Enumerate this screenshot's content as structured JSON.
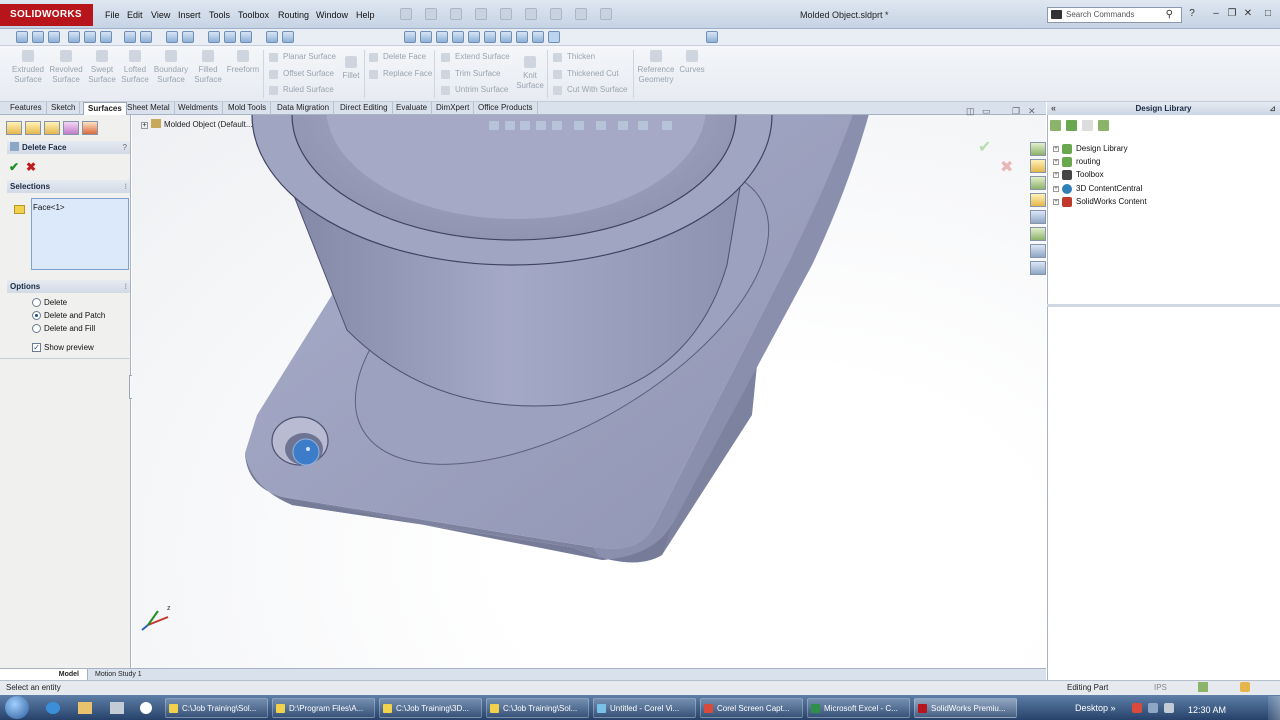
{
  "app": {
    "logo": "SOLIDWORKS",
    "doc_title": "Molded Object.sldprt *",
    "search_placeholder": "Search Commands"
  },
  "menu": [
    "File",
    "Edit",
    "View",
    "Insert",
    "Tools",
    "Toolbox",
    "Routing",
    "Window",
    "Help"
  ],
  "command_manager": {
    "big": [
      {
        "label": "Extruded\nSurface"
      },
      {
        "label": "Revolved\nSurface"
      },
      {
        "label": "Swept\nSurface"
      },
      {
        "label": "Lofted\nSurface"
      },
      {
        "label": "Boundary\nSurface"
      },
      {
        "label": "Filled\nSurface"
      },
      {
        "label": "Freeform"
      }
    ],
    "col1": [
      "Planar Surface",
      "Offset Surface",
      "Ruled Surface"
    ],
    "fillet": "Fillet",
    "col2": [
      "Delete Face",
      "Replace Face"
    ],
    "col3": [
      "Extend Surface",
      "Trim Surface",
      "Untrim Surface"
    ],
    "knit": "Knit\nSurface",
    "col4": [
      "Thicken",
      "Thickened Cut",
      "Cut With Surface"
    ],
    "ref_geometry": "Reference\nGeometry",
    "curves": "Curves"
  },
  "tabs": [
    "Features",
    "Sketch",
    "Surfaces",
    "Sheet Metal",
    "Weldments",
    "Mold Tools",
    "Data Migration",
    "Direct Editing",
    "Evaluate",
    "DimXpert",
    "Office Products"
  ],
  "active_tab": "Surfaces",
  "property_manager": {
    "title": "Delete Face",
    "selections_header": "Selections",
    "selection_value": "Face<1>",
    "options_header": "Options",
    "options": [
      "Delete",
      "Delete and Patch",
      "Delete and Fill"
    ],
    "selected_option": "Delete and Patch",
    "show_preview_label": "Show preview",
    "show_preview": true
  },
  "viewport": {
    "tree_root": "Molded Object  (Default..."
  },
  "design_library": {
    "header": "Design Library",
    "items": [
      {
        "label": "Design Library",
        "color": "#6aa84f"
      },
      {
        "label": "routing",
        "color": "#6aa84f"
      },
      {
        "label": "Toolbox",
        "color": "#444444"
      },
      {
        "label": "3D ContentCentral",
        "color": "#2f7fb8"
      },
      {
        "label": "SolidWorks Content",
        "color": "#c0392b"
      }
    ]
  },
  "bottom_tabs": [
    "Model",
    "Motion Study 1"
  ],
  "status": {
    "left": "Select an entity",
    "mode": "Editing Part",
    "units": "IPS"
  },
  "taskbar": {
    "items": [
      "C:\\Job Training\\Sol...",
      "D:\\Program Files\\A...",
      "C:\\Job Training\\3D...",
      "C:\\Job Training\\Sol...",
      "Untitled - Corel Vi...",
      "Corel Screen Capt...",
      "Microsoft Excel - C...",
      "SolidWorks Premiu..."
    ],
    "active": "SolidWorks Premiu...",
    "desktop_label": "Desktop",
    "clock": "12:30 AM"
  },
  "colors": {
    "part": "#9ea3bd",
    "accent": "#1c4c99",
    "brand": "#b8141b"
  }
}
